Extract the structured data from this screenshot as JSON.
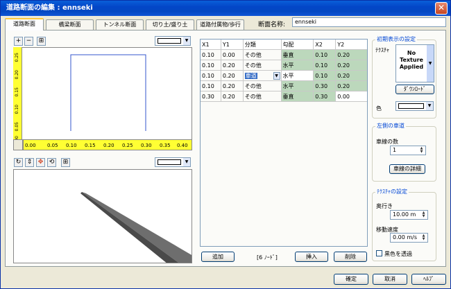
{
  "window": {
    "title": "道路断面の編集 : ennseki",
    "close_glyph": "✕"
  },
  "tabs": [
    {
      "label": "道路断面"
    },
    {
      "label": "橋梁断面"
    },
    {
      "label": "トンネル断面"
    },
    {
      "label": "切り土/盛り土"
    },
    {
      "label": "道路付属物/歩行"
    }
  ],
  "section_name": {
    "label": "断面名称:",
    "value": "ennseki"
  },
  "ruler": {
    "h_ticks": [
      "0.00",
      "0.05",
      "0.10",
      "0.15",
      "0.20",
      "0.25",
      "0.30",
      "0.35",
      "0.40"
    ],
    "v_ticks": [
      "0.25",
      "0.20",
      "0.15",
      "0.10",
      "0.05",
      "0.00"
    ]
  },
  "table": {
    "columns": [
      "X1",
      "Y1",
      "分類",
      "勾配",
      "X2",
      "Y2"
    ],
    "rows": [
      [
        "0.10",
        "0.00",
        "その他",
        "垂直",
        "0.10",
        "0.20"
      ],
      [
        "0.10",
        "0.20",
        "その他",
        "水平",
        "0.10",
        "0.20"
      ],
      [
        "0.10",
        "0.20",
        "車道",
        "水平",
        "0.10",
        "0.20"
      ],
      [
        "0.10",
        "0.20",
        "その他",
        "水平",
        "0.30",
        "0.20"
      ],
      [
        "0.30",
        "0.20",
        "その他",
        "垂直",
        "0.30",
        "0.00"
      ]
    ]
  },
  "footer_bar": {
    "add": "追加",
    "node_count": "[6 ﾉｰﾄﾞ]",
    "insert": "挿入",
    "delete": "削除"
  },
  "initial_display": {
    "title": "初期表示の設定",
    "texture_label": "ﾃｸｽﾁｬ",
    "texture_preview": "No Texture Applied",
    "download": "ﾀﾞｳﾝﾛｰﾄﾞ",
    "color_label": "色"
  },
  "left_lanes": {
    "title": "左側の車道",
    "count_label": "車線の数",
    "count_value": "1",
    "details": "車線の詳細"
  },
  "texture_settings": {
    "title": "ﾃｸｽﾁｬの設定",
    "depth_label": "奥行き",
    "depth_value": "10.00 m",
    "speed_label": "移動速度",
    "speed_value": "0.00 m/s",
    "transparent_label": "黒色を透過"
  },
  "dialog_buttons": {
    "ok": "確定",
    "cancel": "取消",
    "help": "ﾍﾙﾌﾟ"
  },
  "colors": {
    "grid_green": "#bcd8bc",
    "title_blue": "#0346c8",
    "ruler_yellow": "#ffff33"
  }
}
